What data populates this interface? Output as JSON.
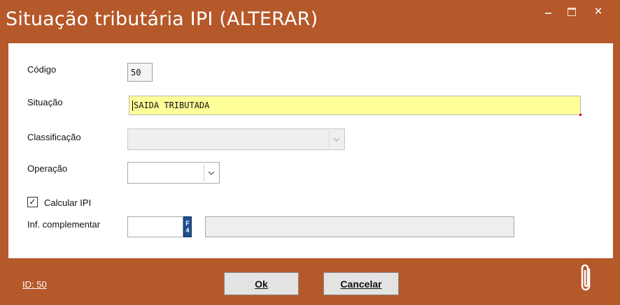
{
  "window": {
    "title": "Situação tributária IPI (ALTERAR)",
    "controls": {
      "minimize": "–",
      "maximize": "□",
      "close": "✕"
    }
  },
  "form": {
    "codigo": {
      "label": "Código",
      "value": "50"
    },
    "situacao": {
      "label": "Situação",
      "value": "SAIDA TRIBUTADA"
    },
    "classificacao": {
      "label": "Classificação",
      "value": ""
    },
    "operacao": {
      "label": "Operação",
      "value": ""
    },
    "calcular_ipi": {
      "label": "Calcular IPI",
      "checked": true,
      "mark": "✓"
    },
    "inf_complementar": {
      "label": "Inf. complementar",
      "code": "",
      "lookup_key": "F4",
      "description": ""
    }
  },
  "footer": {
    "id_text": "ID: 50",
    "ok_label": "Ok",
    "cancel_label": "Cancelar"
  },
  "colors": {
    "window_bg": "#b5582a",
    "highlight_field": "#ffff99",
    "f4_button": "#1e4f8f"
  },
  "icons": {
    "attachment": "paperclip-icon",
    "dropdown": "chevron-down-icon"
  }
}
